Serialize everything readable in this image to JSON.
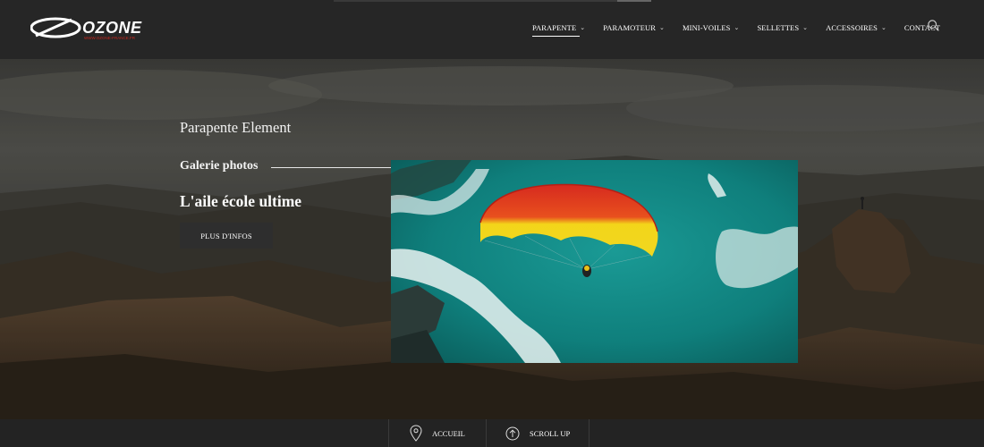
{
  "brand": {
    "name": "OZONE",
    "url": "WWW.OZONE-FRANCE.FR",
    "accent": "#c8281e"
  },
  "nav": {
    "items": [
      {
        "label": "PARAPENTE",
        "has_dropdown": true,
        "active": true
      },
      {
        "label": "PARAMOTEUR",
        "has_dropdown": true,
        "active": false
      },
      {
        "label": "MINI-VOILES",
        "has_dropdown": true,
        "active": false
      },
      {
        "label": "SELLETTES",
        "has_dropdown": true,
        "active": false
      },
      {
        "label": "ACCESSOIRES",
        "has_dropdown": true,
        "active": false
      },
      {
        "label": "CONTACT",
        "has_dropdown": false,
        "active": false
      }
    ],
    "search_icon": "search-icon"
  },
  "hero": {
    "title": "Parapente Element",
    "subtitle": "Galerie photos",
    "tagline": "L'aile école ultime",
    "button_label": "PLUS D'INFOS"
  },
  "footer_bar": {
    "home_label": "ACCUEIL",
    "home_icon": "map-pin-icon",
    "scroll_label": "SCROLL UP",
    "scroll_icon": "arrow-up-circle-icon"
  },
  "colors": {
    "header_bg": "#262626",
    "bottom_bar_bg": "#232323",
    "button_bg": "#2e2e2e",
    "wing_red": "#d62a1f",
    "wing_yellow": "#f3d51a",
    "sea": "#138c88"
  }
}
